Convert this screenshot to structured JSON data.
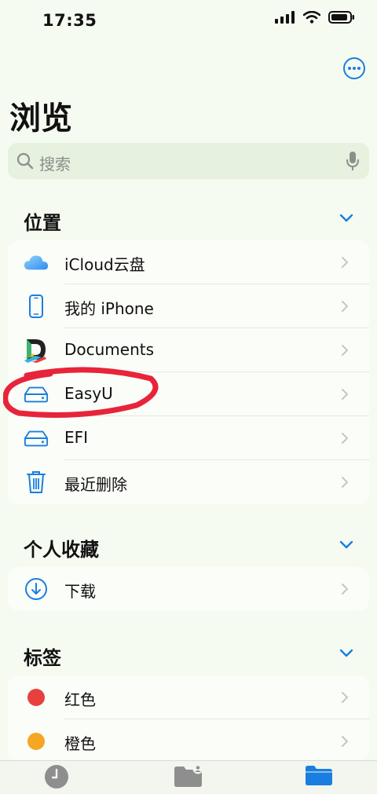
{
  "status": {
    "time": "17:35"
  },
  "title": "浏览",
  "search": {
    "placeholder": "搜索"
  },
  "sections": {
    "locations": {
      "title": "位置",
      "items": [
        {
          "label": "iCloud云盘",
          "icon": "icloud-icon"
        },
        {
          "label": "我的 iPhone",
          "icon": "iphone-icon"
        },
        {
          "label": "Documents",
          "icon": "documents-app-icon"
        },
        {
          "label": "EasyU",
          "icon": "drive-icon"
        },
        {
          "label": "EFI",
          "icon": "drive-icon"
        },
        {
          "label": "最近删除",
          "icon": "trash-icon"
        }
      ]
    },
    "favorites": {
      "title": "个人收藏",
      "items": [
        {
          "label": "下载",
          "icon": "download-icon"
        }
      ]
    },
    "tags": {
      "title": "标签",
      "items": [
        {
          "label": "红色",
          "color": "#e8413d"
        },
        {
          "label": "橙色",
          "color": "#f5a623"
        }
      ]
    }
  },
  "tabs": [
    "recents-tab",
    "shared-tab",
    "browse-tab"
  ],
  "colors": {
    "accent": "#1a7ee0",
    "annotation": "#e8243a",
    "background": "#f6fbf1"
  }
}
